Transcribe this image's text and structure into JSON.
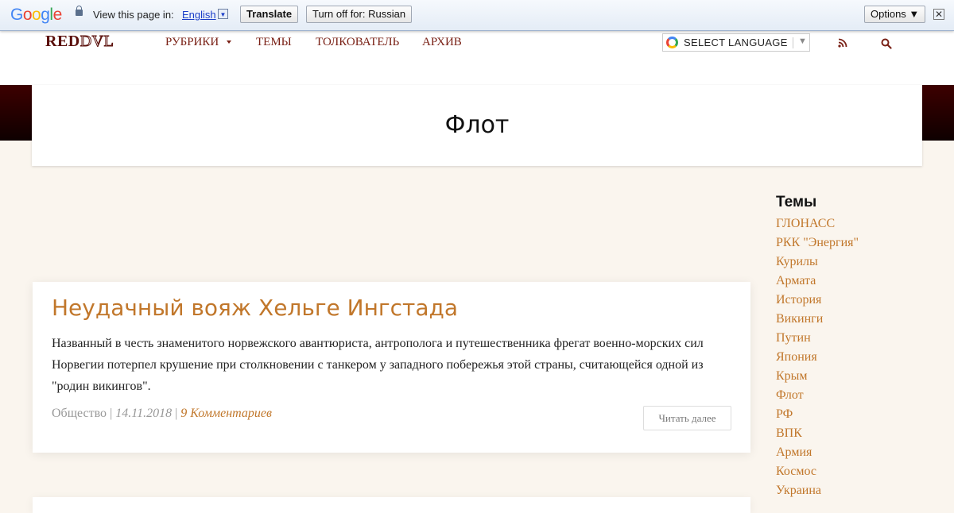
{
  "translate_bar": {
    "logo": "Google",
    "prompt": "View this page in:",
    "language": "English",
    "dropdown_glyph": "▼",
    "translate_label": "Translate",
    "turn_off_label": "Turn off for: Russian",
    "options_label": "Options ▼",
    "close_glyph": "✕"
  },
  "header": {
    "logo_red": "RED",
    "logo_dvl": "DVL",
    "nav": {
      "rubriki": "Рубрики",
      "temy": "Темы",
      "tolkovatel": "Толкователь",
      "arhiv": "Архив"
    },
    "select_language": "SELECT LANGUAGE",
    "select_arrow": "▼"
  },
  "page": {
    "title": "Флот"
  },
  "article": {
    "title": "Неудачный вояж Хельге Ингстада",
    "excerpt": "Названный в честь знаменитого норвежского авантюриста, антрополога и путешественника фрегат военно-морских сил Норвегии потерпел крушение при столкновении с танкером у западного побережья этой страны, считающейся одной из \"родин викингов\".",
    "category": "Общество",
    "sep1": " | ",
    "date": "14.11.2018",
    "sep2": " | ",
    "comments": "9 Комментариев",
    "read_more": "Читать далее"
  },
  "sidebar": {
    "title": "Темы",
    "tags": [
      "ГЛОНАСС",
      "РКК \"Энергия\"",
      "Курилы",
      "Армата",
      "История",
      "Викинги",
      "Путин",
      "Япония",
      "Крым",
      "Флот",
      "РФ",
      "ВПК",
      "Армия",
      "Космос",
      "Украина"
    ]
  },
  "colors": {
    "accent": "#c1772b",
    "nav": "#7a2116",
    "hero": "#2a0000"
  }
}
